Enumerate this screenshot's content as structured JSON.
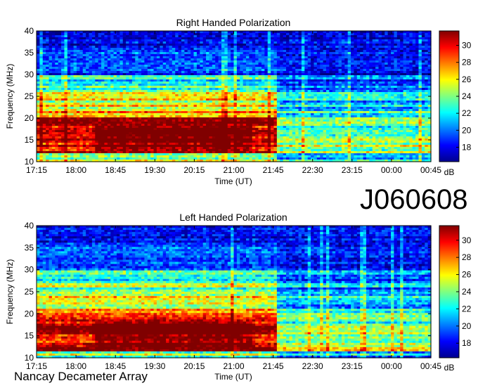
{
  "observation_id": "J060608",
  "instrument": "Nancay Decameter Array",
  "colorbar": {
    "label": "dB",
    "ticks": [
      18,
      20,
      22,
      24,
      26,
      28,
      30
    ],
    "range": [
      16.3,
      31.7
    ],
    "colormap": "jet"
  },
  "chart_data": [
    {
      "type": "heatmap",
      "title": "Right Handed Polarization",
      "xlabel": "Time (UT)",
      "ylabel": "Frequency (MHz)",
      "x_ticks": [
        "17:15",
        "18:00",
        "18:45",
        "19:30",
        "20:15",
        "21:00",
        "21:45",
        "22:30",
        "23:15",
        "00:00",
        "00:45"
      ],
      "y_ticks": [
        10,
        15,
        20,
        25,
        30,
        35,
        40
      ],
      "ylim": [
        10,
        40
      ],
      "colorbar_label": "dB",
      "colorbar_ticks": [
        18,
        20,
        22,
        24,
        26,
        28,
        30
      ],
      "features": "Intense emission (>30 dB) between ~12 and 20 MHz from 17:15 to ~21:50 UT, banded structure up to ~30 MHz; emission weakens after ~21:50 UT"
    },
    {
      "type": "heatmap",
      "title": "Left Handed Polarization",
      "xlabel": "Time (UT)",
      "ylabel": "Frequency (MHz)",
      "x_ticks": [
        "17:15",
        "18:00",
        "18:45",
        "19:30",
        "20:15",
        "21:00",
        "21:45",
        "22:30",
        "23:15",
        "00:00",
        "00:45"
      ],
      "y_ticks": [
        10,
        15,
        20,
        25,
        30,
        35,
        40
      ],
      "ylim": [
        10,
        40
      ],
      "colorbar_label": "dB",
      "colorbar_ticks": [
        18,
        20,
        22,
        24,
        26,
        28,
        30
      ],
      "features": "Similar banded structure, strongest emission between ~12 and 18 MHz before ~22:00 UT, fading afterwards"
    }
  ]
}
